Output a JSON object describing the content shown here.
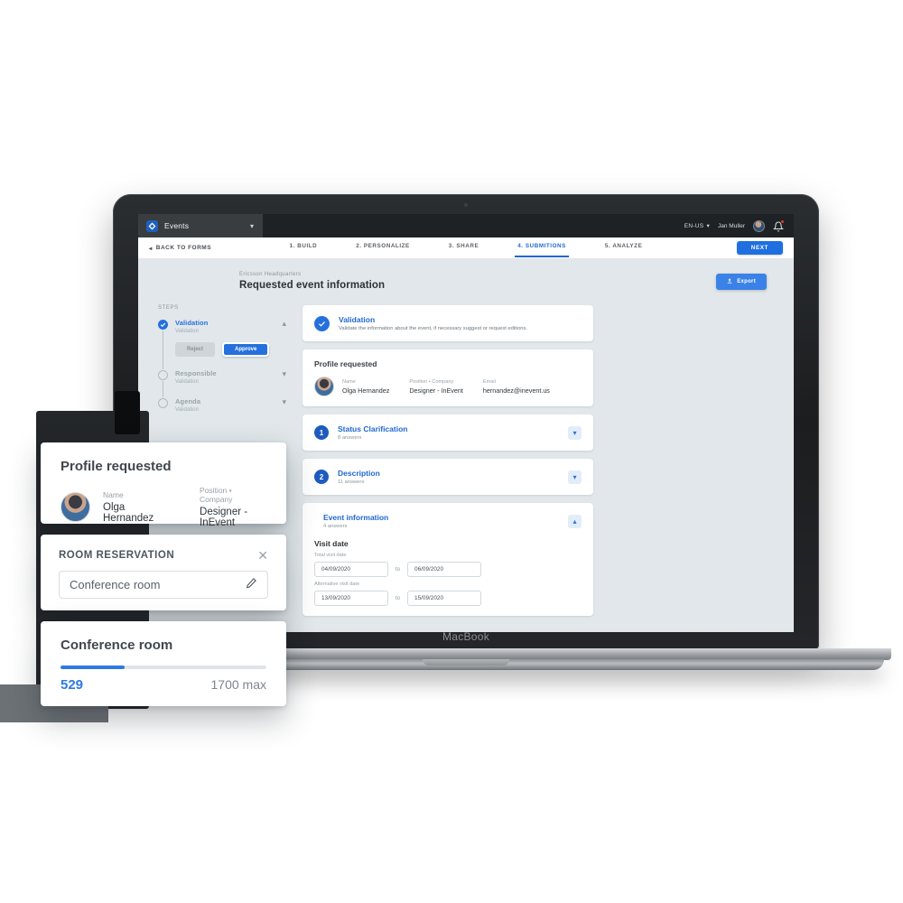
{
  "device": {
    "label": "MacBook"
  },
  "appbar": {
    "logo_icon": "inevent-logo-icon",
    "title": "Events",
    "caret_icon": "chevron-down-icon",
    "language": "EN-US",
    "lang_caret_icon": "caret-down-icon",
    "user_name": "Jan Muller",
    "avatar_icon": "user-avatar",
    "bell_icon": "notification-bell-icon"
  },
  "wizard": {
    "back_label": "BACK TO FORMS",
    "back_icon": "arrow-left-icon",
    "steps": [
      {
        "label": "1. BUILD",
        "active": false
      },
      {
        "label": "2. PERSONALIZE",
        "active": false
      },
      {
        "label": "3. SHARE",
        "active": false
      },
      {
        "label": "4. SUBMITIONS",
        "active": true
      },
      {
        "label": "5. ANALYZE",
        "active": false
      }
    ],
    "next_label": "NEXT"
  },
  "page": {
    "breadcrumb": "Ericsson Headquarters",
    "title": "Requested event information",
    "export_label": "Export",
    "export_icon": "export-icon",
    "steps_label": "STEPS"
  },
  "steps_panel": [
    {
      "name": "Validation",
      "sub": "Validation",
      "state": "done",
      "chevron_icon": "chevron-up-icon",
      "actions": {
        "reject": "Reject",
        "approve": "Approve"
      }
    },
    {
      "name": "Responsible",
      "sub": "Validation",
      "state": "pending",
      "chevron_icon": "chevron-down-icon"
    },
    {
      "name": "Agenda",
      "sub": "Validation",
      "state": "pending",
      "chevron_icon": "chevron-down-icon"
    }
  ],
  "cards": {
    "validation": {
      "title": "Validation",
      "description": "Validate the information about the event, if necessary suggest or request editions.",
      "check_icon": "check-circle-icon"
    },
    "profile": {
      "title": "Profile requested",
      "avatar_icon": "user-avatar",
      "fields": [
        {
          "label": "Name",
          "value": "Olga Hernandez"
        },
        {
          "label": "Position • Company",
          "value": "Designer - InEvent"
        },
        {
          "label": "Email",
          "value": "hernandez@inevent.us"
        }
      ]
    },
    "sections": [
      {
        "number": "1",
        "title": "Status Clarification",
        "answers": "8 answers",
        "chevron_icon": "chevron-down-icon",
        "expanded": false
      },
      {
        "number": "2",
        "title": "Description",
        "answers": "11 answers",
        "chevron_icon": "chevron-down-icon",
        "expanded": false
      }
    ],
    "event_information": {
      "title": "Event information",
      "answers": "4 answers",
      "chevron_icon": "chevron-up-icon",
      "group_title": "Visit date",
      "ranges": [
        {
          "label": "Total visit date",
          "from": "04/09/2020",
          "to_label": "to",
          "to": "06/09/2020"
        },
        {
          "label": "Alternative visit date",
          "from": "13/09/2020",
          "to_label": "to",
          "to": "15/09/2020"
        }
      ]
    }
  },
  "overlays": {
    "profile": {
      "title": "Profile requested",
      "avatar_icon": "user-avatar",
      "fields": [
        {
          "label": "Name",
          "value": "Olga Hernandez"
        },
        {
          "label": "Position • Company",
          "value": "Designer - InEvent"
        }
      ]
    },
    "room_reservation": {
      "kicker": "ROOM RESERVATION",
      "close_icon": "close-icon",
      "input_value": "Conference room",
      "edit_icon": "pencil-icon"
    },
    "capacity": {
      "title": "Conference room",
      "current": "529",
      "max": "1700 max",
      "percent": 31,
      "bar_color": "#2e7ae0"
    }
  }
}
